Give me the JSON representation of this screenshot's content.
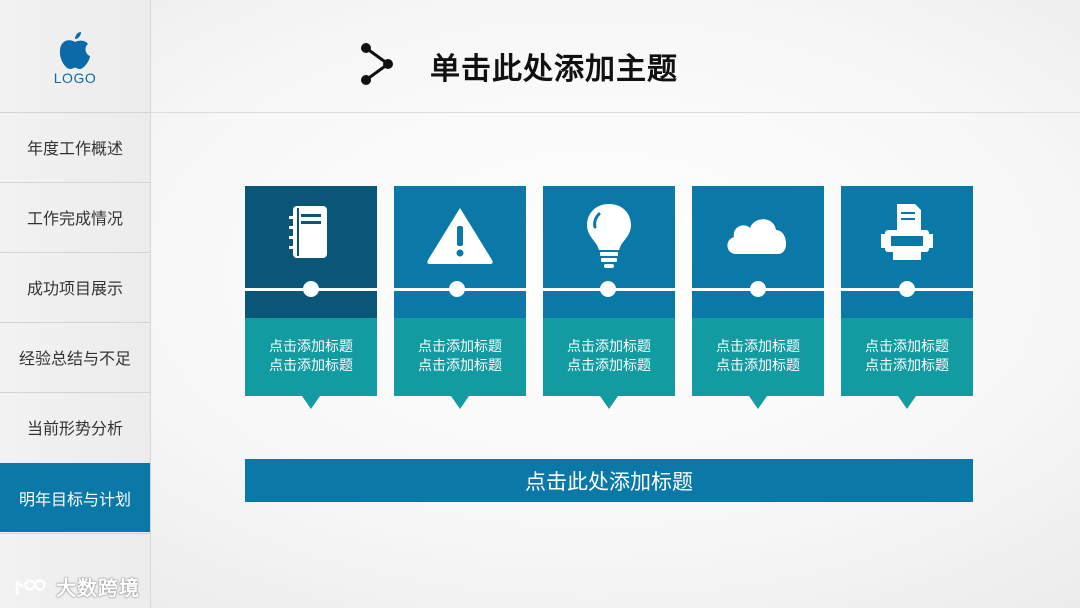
{
  "logo": {
    "text": "LOGO"
  },
  "sidebar": {
    "items": [
      {
        "label": "年度工作概述",
        "active": false
      },
      {
        "label": "工作完成情况",
        "active": false
      },
      {
        "label": "成功项目展示",
        "active": false
      },
      {
        "label": "经验总结与不足",
        "active": false
      },
      {
        "label": "当前形势分析",
        "active": false
      },
      {
        "label": "明年目标与计划",
        "active": true
      }
    ]
  },
  "header": {
    "title": "单击此处添加主题",
    "icon": "share-icon"
  },
  "cards": [
    {
      "icon": "notebook-icon",
      "line1": "点击添加标题",
      "line2": "点击添加标题"
    },
    {
      "icon": "warning-icon",
      "line1": "点击添加标题",
      "line2": "点击添加标题"
    },
    {
      "icon": "lightbulb-icon",
      "line1": "点击添加标题",
      "line2": "点击添加标题"
    },
    {
      "icon": "cloud-icon",
      "line1": "点击添加标题",
      "line2": "点击添加标题"
    },
    {
      "icon": "printer-icon",
      "line1": "点击添加标题",
      "line2": "点击添加标题"
    }
  ],
  "bottom_bar": {
    "label": "点击此处添加标题"
  },
  "watermark": {
    "text": "大数跨境"
  },
  "colors": {
    "primary_blue": "#0b79a7",
    "dark_blue": "#0a5678",
    "teal": "#139ba2",
    "logo_blue": "#0b6aa8"
  }
}
